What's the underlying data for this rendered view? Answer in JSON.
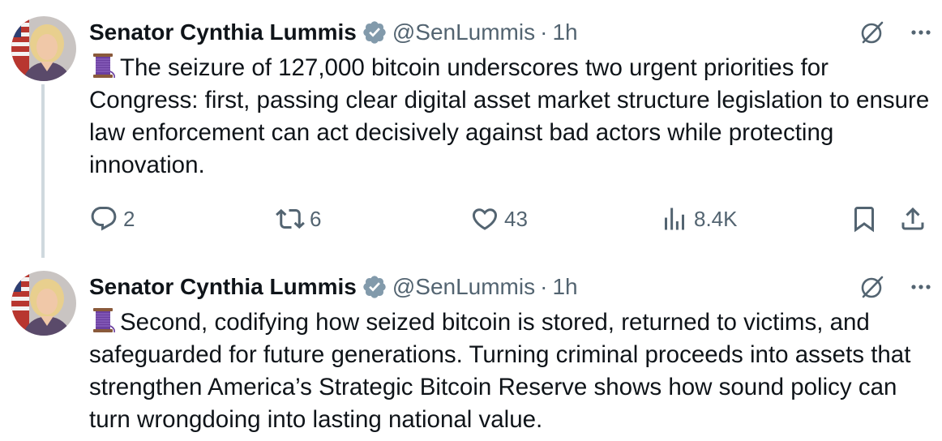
{
  "tweets": [
    {
      "author": {
        "name": "Senator Cynthia Lummis",
        "handle": "@SenLummis",
        "separator": "·",
        "time": "1h"
      },
      "text": "The seizure of 127,000 bitcoin underscores two urgent priorities for Congress: first, passing clear digital asset market structure legislation to ensure law enforcement can act decisively against bad actors while protecting innovation.",
      "emoji_icon": "thread-spool-icon",
      "actions": {
        "replies": "2",
        "reposts": "6",
        "likes": "43",
        "views": "8.4K"
      }
    },
    {
      "author": {
        "name": "Senator Cynthia Lummis",
        "handle": "@SenLummis",
        "separator": "·",
        "time": "1h"
      },
      "text": "Second, codifying how seized bitcoin is stored, returned to victims, and safeguarded for future generations. Turning criminal proceeds into assets that strengthen America’s Strategic Bitcoin Reserve shows how sound policy can turn wrongdoing into lasting national value.",
      "emoji_icon": "thread-spool-icon"
    }
  ],
  "colors": {
    "text": "#0f1419",
    "secondary": "#536471",
    "verified": "#829aab",
    "thread_line": "#cfd9de"
  }
}
